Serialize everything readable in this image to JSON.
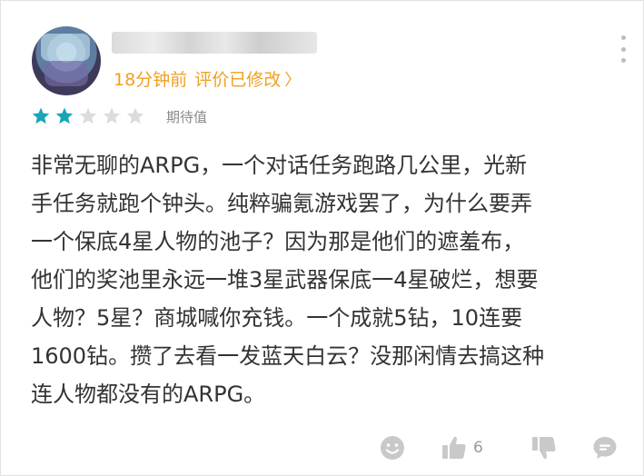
{
  "review": {
    "time_ago": "18分钟前",
    "edited_label": "评价已修改",
    "edited_chevron": "〉",
    "rating": {
      "filled": 2,
      "total": 5,
      "label": "期待值"
    },
    "body": "非常无聊的ARPG，一个对话任务跑路几公里，光新\n手任务就跑个钟头。纯粹骗氪游戏罢了，为什么要弄\n一个保底4星人物的池子？因为那是他们的遮羞布，\n他们的奖池里永远一堆3星武器保底一4星破烂，想要\n人物？5星？商城喊你充钱。一个成就5钻，10连要\n1600钻。攒了去看一发蓝天白云？没那闲情去搞这种\n连人物都没有的ARPG。"
  },
  "actions": {
    "like_count": "6",
    "icons": [
      "emoji-icon",
      "thumbs-up-icon",
      "thumbs-down-icon",
      "comment-icon"
    ]
  },
  "colors": {
    "accent": "#f0a020",
    "star_filled": "#19a4b8",
    "star_empty": "#dcdcdc",
    "icon_gray": "#c4c4c4",
    "text": "#333333"
  }
}
